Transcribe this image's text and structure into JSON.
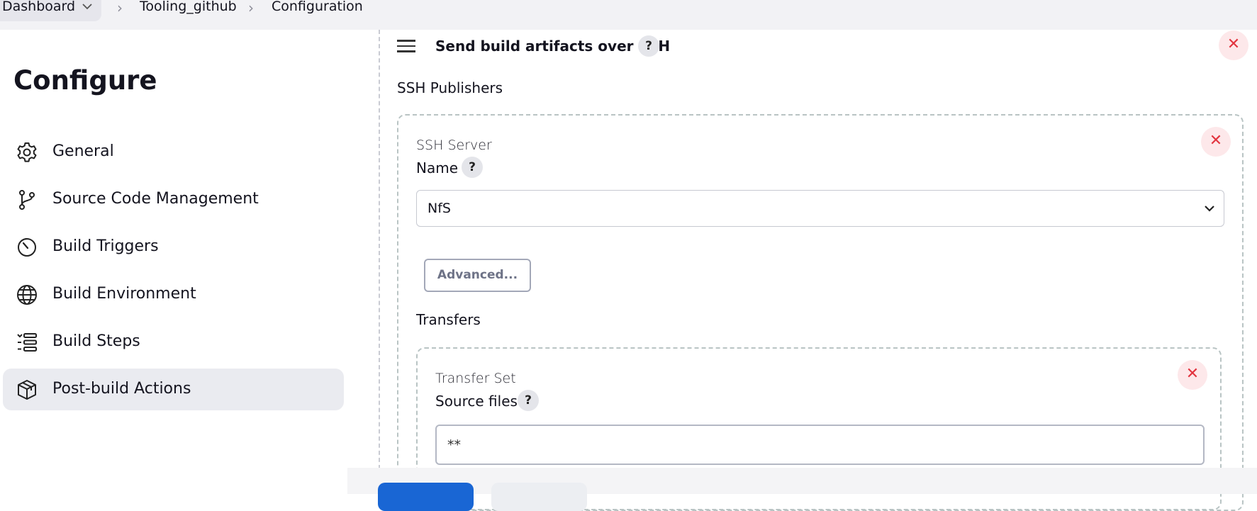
{
  "breadcrumb": {
    "items": [
      "Dashboard",
      "Tooling_github",
      "Configuration"
    ]
  },
  "sidebar": {
    "title": "Configure",
    "items": [
      {
        "label": "General",
        "icon": "gear-icon"
      },
      {
        "label": "Source Code Management",
        "icon": "git-branch-icon"
      },
      {
        "label": "Build Triggers",
        "icon": "clock-icon"
      },
      {
        "label": "Build Environment",
        "icon": "globe-icon"
      },
      {
        "label": "Build Steps",
        "icon": "list-icon"
      },
      {
        "label": "Post-build Actions",
        "icon": "package-icon",
        "active": true
      }
    ]
  },
  "main": {
    "section_title": "Send build artifacts over SSH",
    "publishers_label": "SSH Publishers",
    "server": {
      "heading": "SSH Server",
      "name_label": "Name",
      "name_value": "NfS",
      "advanced_label": "Advanced..."
    },
    "transfers_label": "Transfers",
    "transfer_set": {
      "heading": "Transfer Set",
      "source_label": "Source files",
      "source_value": "**"
    },
    "help_glyph": "?",
    "close_glyph": "✕"
  },
  "colors": {
    "accent": "#1966d4",
    "danger": "#e2343f",
    "active_nav": "#eaebf0"
  }
}
